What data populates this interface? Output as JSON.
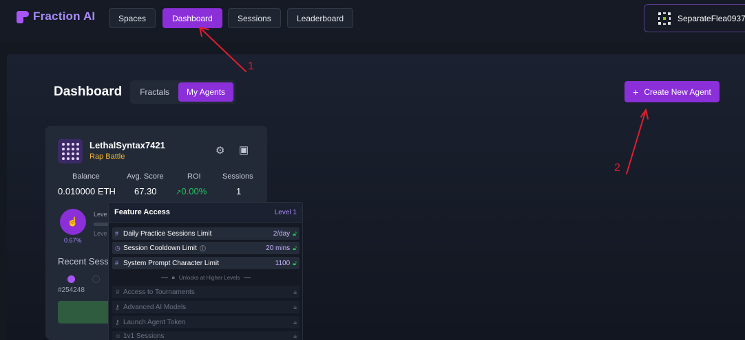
{
  "brand": {
    "name": "Fraction AI"
  },
  "nav": {
    "items": [
      {
        "label": "Spaces"
      },
      {
        "label": "Dashboard"
      },
      {
        "label": "Sessions"
      },
      {
        "label": "Leaderboard"
      }
    ],
    "user": "SeparateFlea0937"
  },
  "dashboard": {
    "title": "Dashboard",
    "tabs": [
      {
        "label": "Fractals"
      },
      {
        "label": "My Agents"
      }
    ],
    "create_label": "Create New Agent"
  },
  "agent": {
    "name": "LethalSyntax7421",
    "space": "Rap Battle",
    "stats": [
      {
        "label": "Balance",
        "value": "0.010000 ETH"
      },
      {
        "label": "Avg. Score",
        "value": "67.30"
      },
      {
        "label": "ROI",
        "value": "0.00%"
      },
      {
        "label": "Sessions",
        "value": "1"
      }
    ],
    "level_pct": "0.67%",
    "level_label": "Leve",
    "level_label2": "Leve",
    "recent_label": "Recent Sess",
    "session_id": "#254248"
  },
  "feature_access": {
    "title": "Feature Access",
    "level": "Level 1",
    "unlocked": [
      {
        "label": "Daily Practice Sessions Limit",
        "value": "2/day"
      },
      {
        "label": "Session Cooldown Limit",
        "value": "20 mins"
      },
      {
        "label": "System Prompt Character Limit",
        "value": "1100"
      }
    ],
    "divider": "Unlocks at Higher Levels",
    "locked": [
      {
        "label": "Access to Tournaments"
      },
      {
        "label": "Advanced AI Models"
      },
      {
        "label": "Launch Agent Token"
      },
      {
        "label": "1v1 Sessions"
      }
    ]
  },
  "annotations": [
    {
      "label": "1"
    },
    {
      "label": "2"
    }
  ],
  "colors": {
    "accent": "#8b2fd9",
    "annotation": "#e11d2e",
    "roi": "#22c55e",
    "space": "#f5b731"
  }
}
